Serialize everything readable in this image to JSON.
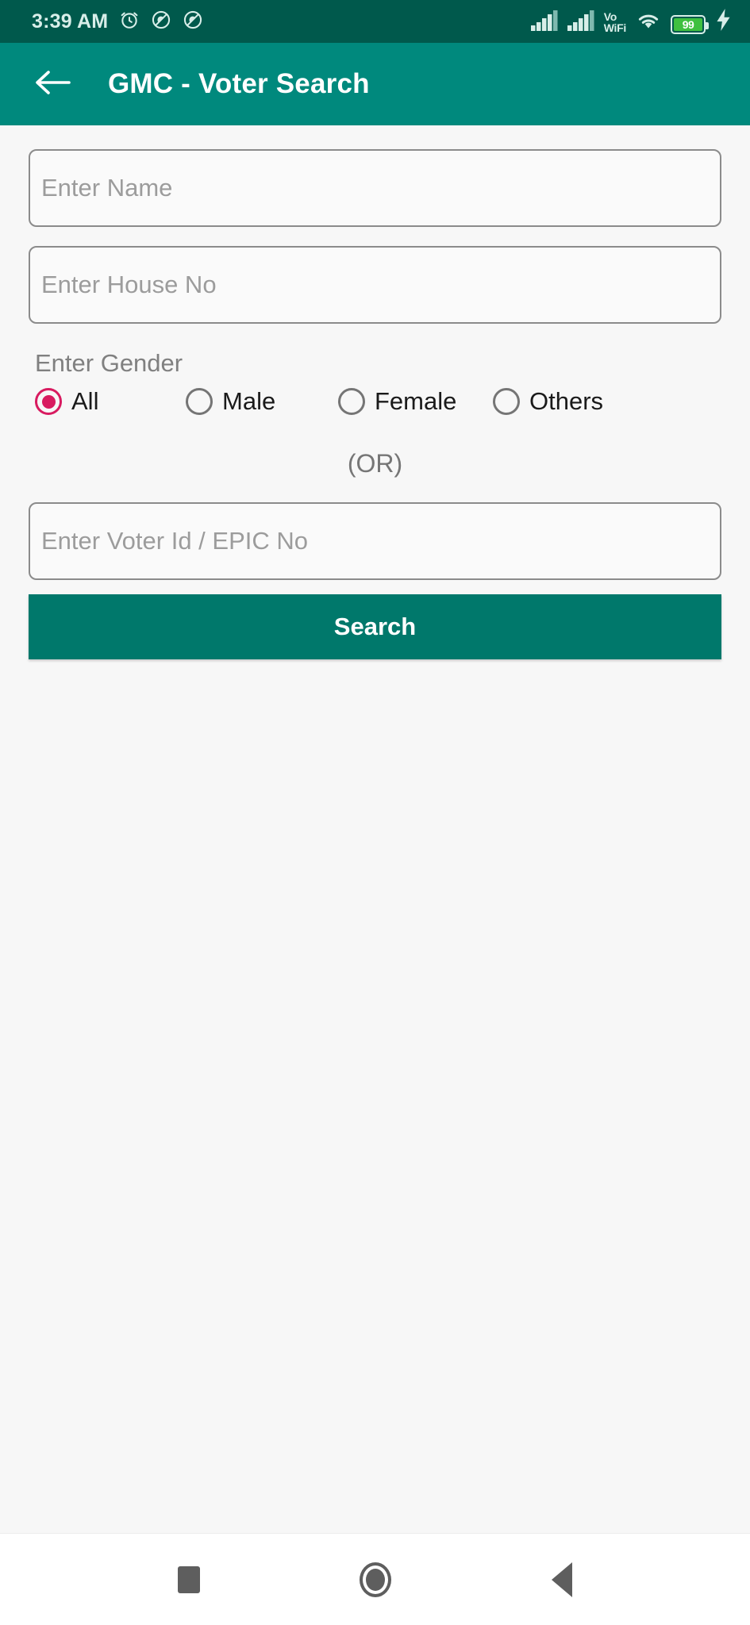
{
  "status_bar": {
    "time": "3:39 AM",
    "left_icons": [
      "alarm-icon",
      "mute-ring-icon",
      "mute-vibrate-icon"
    ],
    "network_label_top": "Vo",
    "network_label_bottom": "WiFi",
    "battery_level": "99",
    "right_icons": [
      "signal-sim1-icon",
      "signal-sim2-icon",
      "volte-wifi-icon",
      "wifi-icon",
      "battery-icon",
      "charging-bolt-icon"
    ],
    "colors": {
      "background": "#00594C",
      "foreground": "#D8EEE9",
      "battery_fill": "#3FC040"
    }
  },
  "app_bar": {
    "back_icon": "arrow-left-icon",
    "title": "GMC - Voter Search",
    "colors": {
      "background": "#00897D",
      "title": "#FFFFFF"
    }
  },
  "form": {
    "name_placeholder": "Enter Name",
    "house_no_placeholder": "Enter House No",
    "gender_label": "Enter Gender",
    "gender_options": [
      {
        "label": "All",
        "selected": true
      },
      {
        "label": "Male",
        "selected": false
      },
      {
        "label": "Female",
        "selected": false
      },
      {
        "label": "Others",
        "selected": false
      }
    ],
    "separator_text": "(OR)",
    "voter_id_placeholder": "Enter Voter Id / EPIC No",
    "search_button_label": "Search",
    "colors": {
      "accent_selected_radio": "#D81B60",
      "search_button_bg": "#00786B",
      "field_border": "#8B8B8B",
      "placeholder": "#9C9C9C",
      "page_background": "#F7F7F7"
    }
  },
  "nav_bar": {
    "items": [
      "recents-square-icon",
      "home-circle-icon",
      "back-triangle-icon"
    ],
    "colors": {
      "background": "#FFFFFF",
      "icon": "#5E5E5E"
    }
  }
}
